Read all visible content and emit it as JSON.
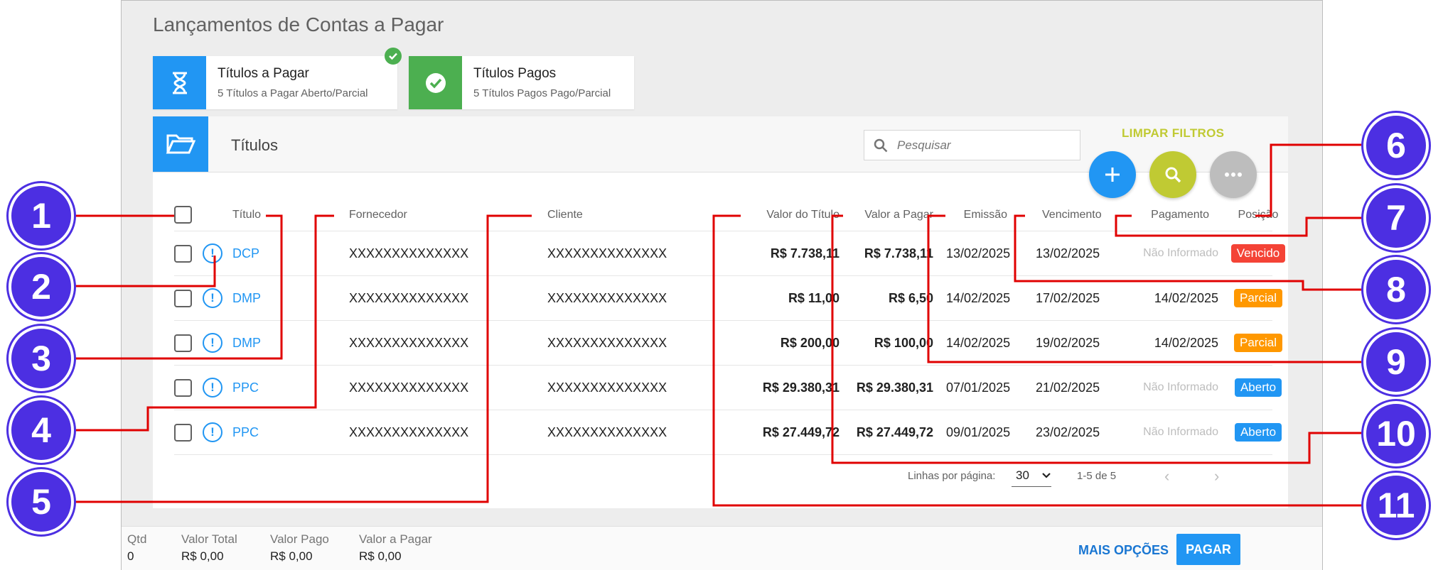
{
  "page_title": "Lançamentos de Contas a Pagar",
  "cards": [
    {
      "title": "Títulos a Pagar",
      "subtitle": "5 Títulos a Pagar Aberto/Parcial"
    },
    {
      "title": "Títulos Pagos",
      "subtitle": "5 Títulos Pagos Pago/Parcial"
    }
  ],
  "panel": {
    "title": "Títulos",
    "search_placeholder": "Pesquisar",
    "clear_filters": "LIMPAR FILTROS"
  },
  "columns": {
    "titulo": "Título",
    "fornecedor": "Fornecedor",
    "cliente": "Cliente",
    "valor_titulo": "Valor do Título",
    "valor_pagar": "Valor a Pagar",
    "emissao": "Emissão",
    "vencimento": "Vencimento",
    "pagamento": "Pagamento",
    "posicao": "Posição"
  },
  "rows": [
    {
      "titulo": "DCP",
      "fornecedor": "XXXXXXXXXXXXXX",
      "cliente": "XXXXXXXXXXXXXX",
      "valor_titulo": "R$ 7.738,11",
      "valor_pagar": "R$ 7.738,11",
      "emissao": "13/02/2025",
      "vencimento": "13/02/2025",
      "pagamento": "Não Informado",
      "posicao": "Vencido",
      "posicao_color": "#f44336"
    },
    {
      "titulo": "DMP",
      "fornecedor": "XXXXXXXXXXXXXX",
      "cliente": "XXXXXXXXXXXXXX",
      "valor_titulo": "R$ 11,00",
      "valor_pagar": "R$ 6,50",
      "emissao": "14/02/2025",
      "vencimento": "17/02/2025",
      "pagamento": "14/02/2025",
      "posicao": "Parcial",
      "posicao_color": "#ff9800"
    },
    {
      "titulo": "DMP",
      "fornecedor": "XXXXXXXXXXXXXX",
      "cliente": "XXXXXXXXXXXXXX",
      "valor_titulo": "R$ 200,00",
      "valor_pagar": "R$ 100,00",
      "emissao": "14/02/2025",
      "vencimento": "19/02/2025",
      "pagamento": "14/02/2025",
      "posicao": "Parcial",
      "posicao_color": "#ff9800"
    },
    {
      "titulo": "PPC",
      "fornecedor": "XXXXXXXXXXXXXX",
      "cliente": "XXXXXXXXXXXXXX",
      "valor_titulo": "R$ 29.380,31",
      "valor_pagar": "R$ 29.380,31",
      "emissao": "07/01/2025",
      "vencimento": "21/02/2025",
      "pagamento": "Não Informado",
      "posicao": "Aberto",
      "posicao_color": "#2196f3"
    },
    {
      "titulo": "PPC",
      "fornecedor": "XXXXXXXXXXXXXX",
      "cliente": "XXXXXXXXXXXXXX",
      "valor_titulo": "R$ 27.449,72",
      "valor_pagar": "R$ 27.449,72",
      "emissao": "09/01/2025",
      "vencimento": "23/02/2025",
      "pagamento": "Não Informado",
      "posicao": "Aberto",
      "posicao_color": "#2196f3"
    }
  ],
  "warn_symbol": "!",
  "pager": {
    "label": "Linhas por página:",
    "rows_per_page": "30",
    "range": "1-5 de 5"
  },
  "footer": {
    "qtd_label": "Qtd",
    "qtd_value": "0",
    "total_label": "Valor Total",
    "total_value": "R$ 0,00",
    "pago_label": "Valor Pago",
    "pago_value": "R$ 0,00",
    "pagar_label": "Valor a Pagar",
    "pagar_value": "R$ 0,00",
    "more_options": "MAIS OPÇÕES",
    "pay": "PAGAR"
  },
  "markers": [
    "1",
    "2",
    "3",
    "4",
    "5",
    "6",
    "7",
    "8",
    "9",
    "10",
    "11"
  ],
  "colors": {
    "primary": "#2196f3",
    "success": "#4caf50",
    "accent": "#c0ca33",
    "annotation": "#4c2fe2",
    "connector": "#e00000"
  },
  "icons": [
    "hourglass-icon",
    "check-circle-icon",
    "folder-open-icon",
    "search-icon",
    "plus-icon",
    "more-icon",
    "warning-icon",
    "chevron-left-icon",
    "chevron-right-icon"
  ]
}
